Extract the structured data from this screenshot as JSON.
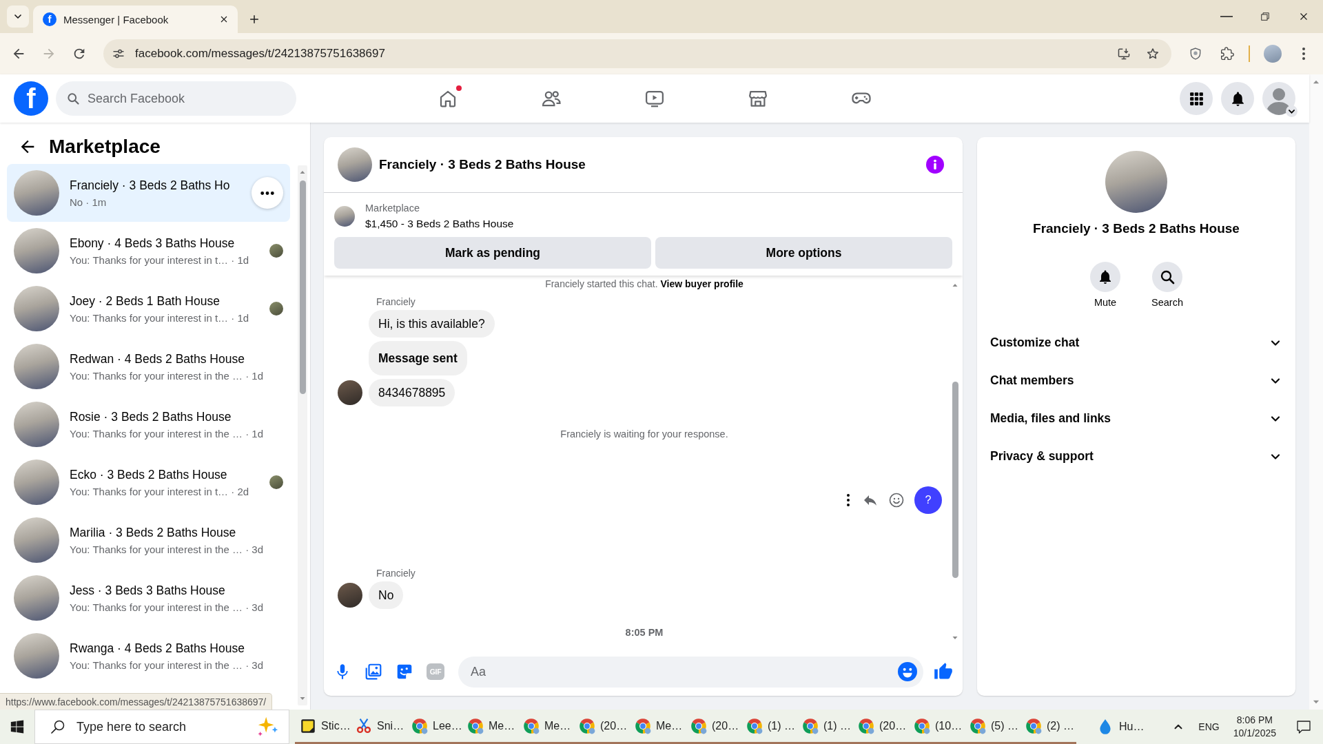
{
  "browser": {
    "tabs": [
      {
        "title": "Messenger | Facebook",
        "favicon": "f",
        "selected": true
      }
    ],
    "nav": [
      {
        "kind": "back",
        "disabled": false
      },
      {
        "kind": "forward",
        "disabled": true
      },
      {
        "kind": "reload",
        "disabled": false
      }
    ],
    "url": "facebook.com/messages/t/24213875751638697",
    "status_url": "https://www.facebook.com/messages/t/24213875751638697/"
  },
  "header": {
    "logo": "f",
    "search": {
      "placeholder": "Search Facebook"
    },
    "nav": [
      {
        "kind": "home",
        "notification": true
      },
      {
        "kind": "friends",
        "notification": false
      },
      {
        "kind": "video",
        "notification": false
      },
      {
        "kind": "store",
        "notification": false
      },
      {
        "kind": "games",
        "notification": false
      }
    ]
  },
  "sidebar": {
    "title": "Marketplace",
    "conversations": [
      {
        "title": "Franciely · 3 Beds 2 Baths Ho",
        "subtitle": "No · 1m",
        "selected": true,
        "hovered": true,
        "seen": false
      },
      {
        "title": "Ebony · 4 Beds 3 Baths House",
        "subtitle": "You: Thanks for your interest in t… · 1d",
        "selected": false,
        "hovered": false,
        "seen": true
      },
      {
        "title": "Joey · 2 Beds 1 Bath House",
        "subtitle": "You: Thanks for your interest in t… · 1d",
        "selected": false,
        "hovered": false,
        "seen": true
      },
      {
        "title": "Redwan · 4 Beds 2 Baths House",
        "subtitle": "You: Thanks for your interest in the … · 1d",
        "selected": false,
        "hovered": false,
        "seen": false
      },
      {
        "title": "Rosie · 3 Beds 2 Baths House",
        "subtitle": "You: Thanks for your interest in the … · 1d",
        "selected": false,
        "hovered": false,
        "seen": false
      },
      {
        "title": "Ecko · 3 Beds 2 Baths House",
        "subtitle": "You: Thanks for your interest in t… · 2d",
        "selected": false,
        "hovered": false,
        "seen": true
      },
      {
        "title": "Marilia · 3 Beds 2 Baths House",
        "subtitle": "You: Thanks for your interest in the … · 3d",
        "selected": false,
        "hovered": false,
        "seen": false
      },
      {
        "title": "Jess · 3 Beds 3 Baths House",
        "subtitle": "You: Thanks for your interest in the … · 3d",
        "selected": false,
        "hovered": false,
        "seen": false
      },
      {
        "title": "Rwanga · 4 Beds 2 Baths House",
        "subtitle": "You: Thanks for your interest in the … · 3d",
        "selected": false,
        "hovered": false,
        "seen": false
      }
    ]
  },
  "chat": {
    "title": "Franciely · 3 Beds 2 Baths House",
    "listing": {
      "source": "Marketplace",
      "text": "$1,450 - 3 Beds 2 Baths House"
    },
    "actions": [
      {
        "label": "Mark as pending"
      },
      {
        "label": "More options"
      }
    ],
    "timeline": [
      {
        "kind": "notice",
        "text": "Franciely started this chat.",
        "link": "View buyer profile"
      },
      {
        "kind": "group",
        "sender": "Franciely",
        "messages": [
          {
            "text": "Hi, is this available?",
            "bold": false
          },
          {
            "text": "Message sent",
            "bold": true
          },
          {
            "text": "8434678895",
            "bold": false
          }
        ]
      },
      {
        "kind": "status",
        "text": "Franciely is waiting for your response."
      },
      {
        "kind": "hover_actions",
        "help": "?"
      },
      {
        "kind": "group",
        "sender": "Franciely",
        "messages": [
          {
            "text": "No",
            "bold": false
          }
        ]
      },
      {
        "kind": "time",
        "text": "8:05 PM"
      }
    ],
    "composer": {
      "gif": {
        "label": "GIF",
        "disabled": true
      },
      "placeholder": "Aa"
    }
  },
  "details": {
    "name": "Franciely · 3 Beds 2 Baths House",
    "buttons": [
      {
        "kind": "mute",
        "label": "Mute"
      },
      {
        "kind": "search",
        "label": "Search"
      }
    ],
    "sections": [
      {
        "label": "Customize chat",
        "expanded": false
      },
      {
        "label": "Chat members",
        "expanded": false
      },
      {
        "label": "Media, files and links",
        "expanded": false
      },
      {
        "label": "Privacy & support",
        "expanded": false
      }
    ]
  },
  "taskbar": {
    "search": {
      "placeholder": "Type here to search"
    },
    "apps": [
      {
        "kind": "notes",
        "label": "Stic…"
      },
      {
        "kind": "snip",
        "label": "Sni…"
      },
      {
        "kind": "browser",
        "label": "Lee…"
      },
      {
        "kind": "browser",
        "label": "Me…"
      },
      {
        "kind": "browser",
        "label": "Me…"
      },
      {
        "kind": "browser",
        "label": "(20…"
      },
      {
        "kind": "browser",
        "label": "Me…"
      },
      {
        "kind": "browser",
        "label": "(20…"
      },
      {
        "kind": "browser",
        "label": "(1) …"
      },
      {
        "kind": "browser",
        "label": "(1) …"
      },
      {
        "kind": "browser",
        "label": "(20…"
      },
      {
        "kind": "browser",
        "label": "(10…"
      },
      {
        "kind": "browser",
        "label": "(5) …"
      },
      {
        "kind": "browser",
        "label": "(2) …"
      }
    ],
    "widget": {
      "kind": "drop",
      "label": "Hu…"
    },
    "language": "ENG",
    "time": "8:06 PM",
    "date": "10/1/2025"
  }
}
